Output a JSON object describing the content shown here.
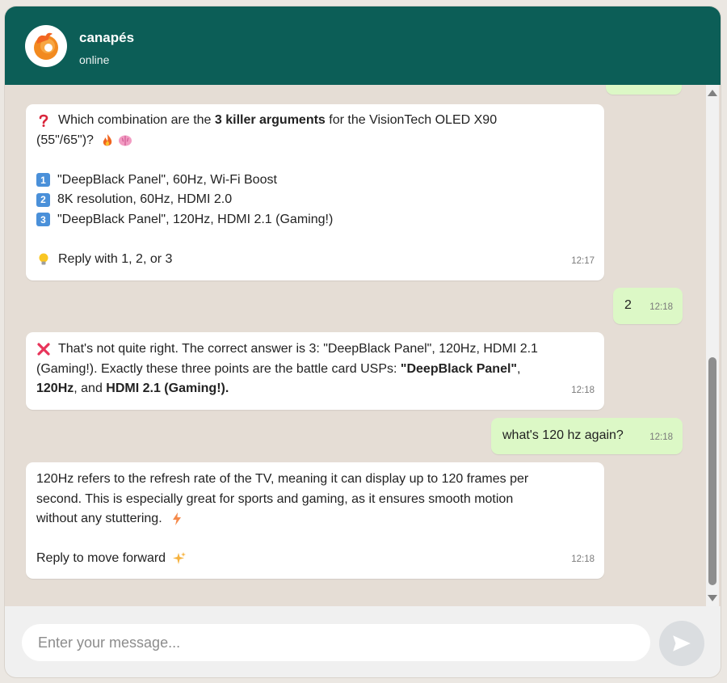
{
  "header": {
    "name": "canapés",
    "status": "online"
  },
  "messages": [
    {
      "id": "q1",
      "question_pre": "Which combination are the ",
      "question_bold": "3 killer arguments",
      "question_post": " for the VisionTech OLED X90",
      "question_line2": "(55\"/65\")?",
      "options": [
        {
          "n": "1",
          "text": "\"DeepBlack Panel\", 60Hz, Wi-Fi Boost"
        },
        {
          "n": "2",
          "text": "8K resolution, 60Hz, HDMI 2.0"
        },
        {
          "n": "3",
          "text": "\"DeepBlack Panel\", 120Hz, HDMI 2.1 (Gaming!)"
        }
      ],
      "hint": "Reply with 1, 2, or 3",
      "time": "12:17"
    },
    {
      "id": "a1",
      "text": "2",
      "time": "12:18"
    },
    {
      "id": "fb1",
      "line1": "That's not quite right. The correct answer is 3: \"DeepBlack Panel\", 120Hz, HDMI 2.1",
      "line2_pre": "(Gaming!). Exactly these three points are the battle card USPs: ",
      "line2_bold": "\"DeepBlack Panel\"",
      "line2_post": ",",
      "line3_bold1": "120Hz",
      "line3_mid": ", and ",
      "line3_bold2": "HDMI 2.1 (Gaming!).",
      "time": "12:18"
    },
    {
      "id": "a2",
      "text": "what's 120 hz again?",
      "time": "12:18"
    },
    {
      "id": "info1",
      "line1": "120Hz refers to the refresh rate of the TV, meaning it can display up to 120 frames per",
      "line2": "second. This is especially great for sports and gaming, as it ensures smooth motion",
      "line3": "without any stuttering.",
      "line5": "Reply to move forward",
      "time": "12:18"
    }
  ],
  "composer": {
    "placeholder": "Enter your message..."
  },
  "colors": {
    "header": "#0c5e57",
    "outgoing": "#dcf8c6",
    "incoming": "#ffffff",
    "background": "#e5ddd5"
  }
}
